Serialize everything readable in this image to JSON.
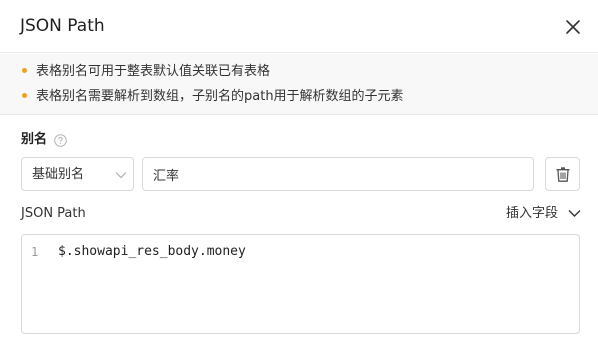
{
  "dialog": {
    "title": "JSON Path"
  },
  "notice": {
    "items": [
      "表格别名可用于整表默认值关联已有表格",
      "表格别名需要解析到数组，子别名的path用于解析数组的子元素"
    ]
  },
  "alias": {
    "label": "别名",
    "type_selected": "基础别名",
    "value": "汇率"
  },
  "json_path": {
    "label": "JSON Path",
    "insert_field_label": "插入字段",
    "line_number": "1",
    "code": "$.showapi_res_body.money"
  },
  "icons": {
    "close": "close-icon",
    "help": "help-icon",
    "chevron": "chevron-down-icon",
    "delete": "trash-icon"
  },
  "colors": {
    "notice_dot": "#f0a020",
    "notice_background": "#f7f8f7"
  }
}
